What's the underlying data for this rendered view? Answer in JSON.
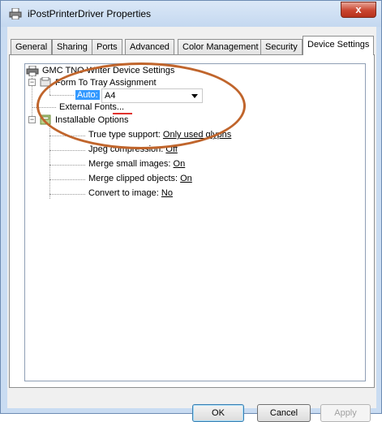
{
  "window": {
    "title": "iPostPrinterDriver Properties",
    "close_glyph": "x"
  },
  "tabs": [
    {
      "label": "General"
    },
    {
      "label": "Sharing"
    },
    {
      "label": "Ports"
    },
    {
      "label": "Advanced"
    },
    {
      "label": "Color Management"
    },
    {
      "label": "Security"
    },
    {
      "label": "Device Settings",
      "active": true
    }
  ],
  "tree": {
    "root": "GMC TNO Writer Device Settings",
    "form_to_tray": "Form To Tray Assignment",
    "auto": {
      "label": "Auto:",
      "value": "A4"
    },
    "external_fonts": "External Fonts...",
    "installable_options": "Installable Options",
    "options": [
      {
        "label": "True type support:",
        "value": "Only used glyphs"
      },
      {
        "label": "Jpeg compression:",
        "value": "Off"
      },
      {
        "label": "Merge small images:",
        "value": "On"
      },
      {
        "label": "Merge clipped objects:",
        "value": "On"
      },
      {
        "label": "Convert to image:",
        "value": "No"
      }
    ]
  },
  "buttons": {
    "ok": "OK",
    "cancel": "Cancel",
    "apply": "Apply"
  },
  "colors": {
    "annotation_ellipse": "#c0652c",
    "annotation_underline": "#e0322d",
    "selection": "#3399ff"
  }
}
